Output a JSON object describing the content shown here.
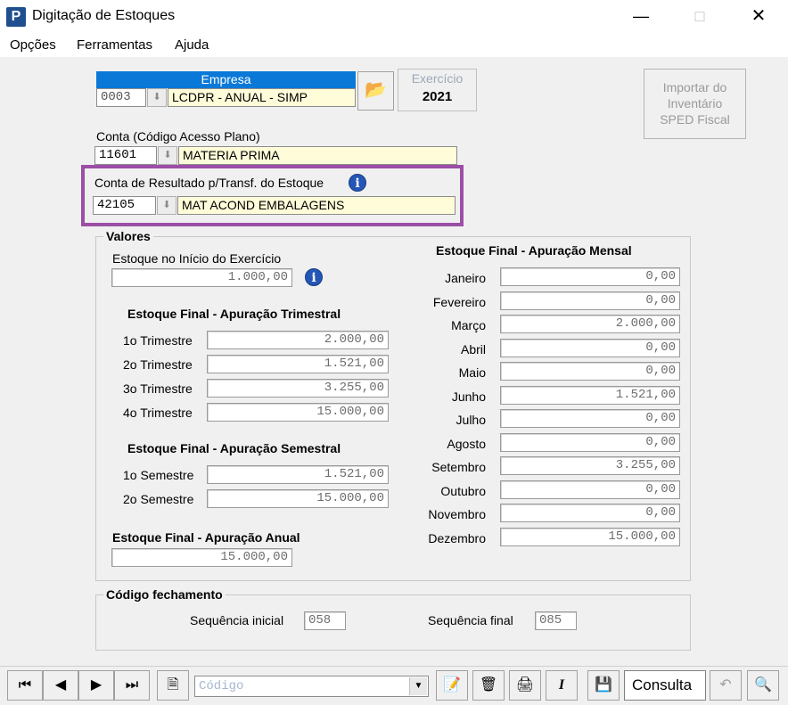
{
  "window": {
    "title": "Digitação de Estoques",
    "icon_letter": "P"
  },
  "menu": {
    "items": [
      "Opções",
      "Ferramentas",
      "Ajuda"
    ]
  },
  "empresa": {
    "label": "Empresa",
    "code": "0003",
    "name": "LCDPR - ANUAL - SIMP"
  },
  "exercicio": {
    "label": "Exercício",
    "value": "2021"
  },
  "importar": {
    "label_l1": "Importar do",
    "label_l2": "Inventário",
    "label_l3": "SPED Fiscal"
  },
  "conta": {
    "label": "Conta (Código Acesso Plano)",
    "code": "11601",
    "name": "MATERIA PRIMA"
  },
  "conta_resultado": {
    "label": "Conta de Resultado p/Transf. do Estoque",
    "code": "42105",
    "name": "MAT ACOND EMBALAGENS"
  },
  "valores": {
    "title": "Valores",
    "inicio_label": "Estoque no Início do Exercício",
    "inicio_value": "1.000,00",
    "trimestral": {
      "title": "Estoque Final - Apuração Trimestral",
      "rows": [
        {
          "label": "1o Trimestre",
          "value": "2.000,00"
        },
        {
          "label": "2o Trimestre",
          "value": "1.521,00"
        },
        {
          "label": "3o Trimestre",
          "value": "3.255,00"
        },
        {
          "label": "4o Trimestre",
          "value": "15.000,00"
        }
      ]
    },
    "semestral": {
      "title": "Estoque Final - Apuração Semestral",
      "rows": [
        {
          "label": "1o Semestre",
          "value": "1.521,00"
        },
        {
          "label": "2o Semestre",
          "value": "15.000,00"
        }
      ]
    },
    "anual": {
      "title": "Estoque Final - Apuração Anual",
      "value": "15.000,00"
    },
    "mensal": {
      "title": "Estoque Final - Apuração Mensal",
      "rows": [
        {
          "label": "Janeiro",
          "value": "0,00"
        },
        {
          "label": "Fevereiro",
          "value": "0,00"
        },
        {
          "label": "Março",
          "value": "2.000,00"
        },
        {
          "label": "Abril",
          "value": "0,00"
        },
        {
          "label": "Maio",
          "value": "0,00"
        },
        {
          "label": "Junho",
          "value": "1.521,00"
        },
        {
          "label": "Julho",
          "value": "0,00"
        },
        {
          "label": "Agosto",
          "value": "0,00"
        },
        {
          "label": "Setembro",
          "value": "3.255,00"
        },
        {
          "label": "Outubro",
          "value": "0,00"
        },
        {
          "label": "Novembro",
          "value": "0,00"
        },
        {
          "label": "Dezembro",
          "value": "15.000,00"
        }
      ]
    }
  },
  "fechamento": {
    "title": "Código fechamento",
    "seq_inicial_label": "Sequência inicial",
    "seq_inicial_value": "058",
    "seq_final_label": "Sequência final",
    "seq_final_value": "085"
  },
  "toolbar": {
    "codigo_placeholder": "Código",
    "consulta_label": "Consulta"
  },
  "colors": {
    "highlight_border": "#9b4fa6",
    "empresa_header": "#0a78d7",
    "field_yellow": "#fffcd9"
  }
}
